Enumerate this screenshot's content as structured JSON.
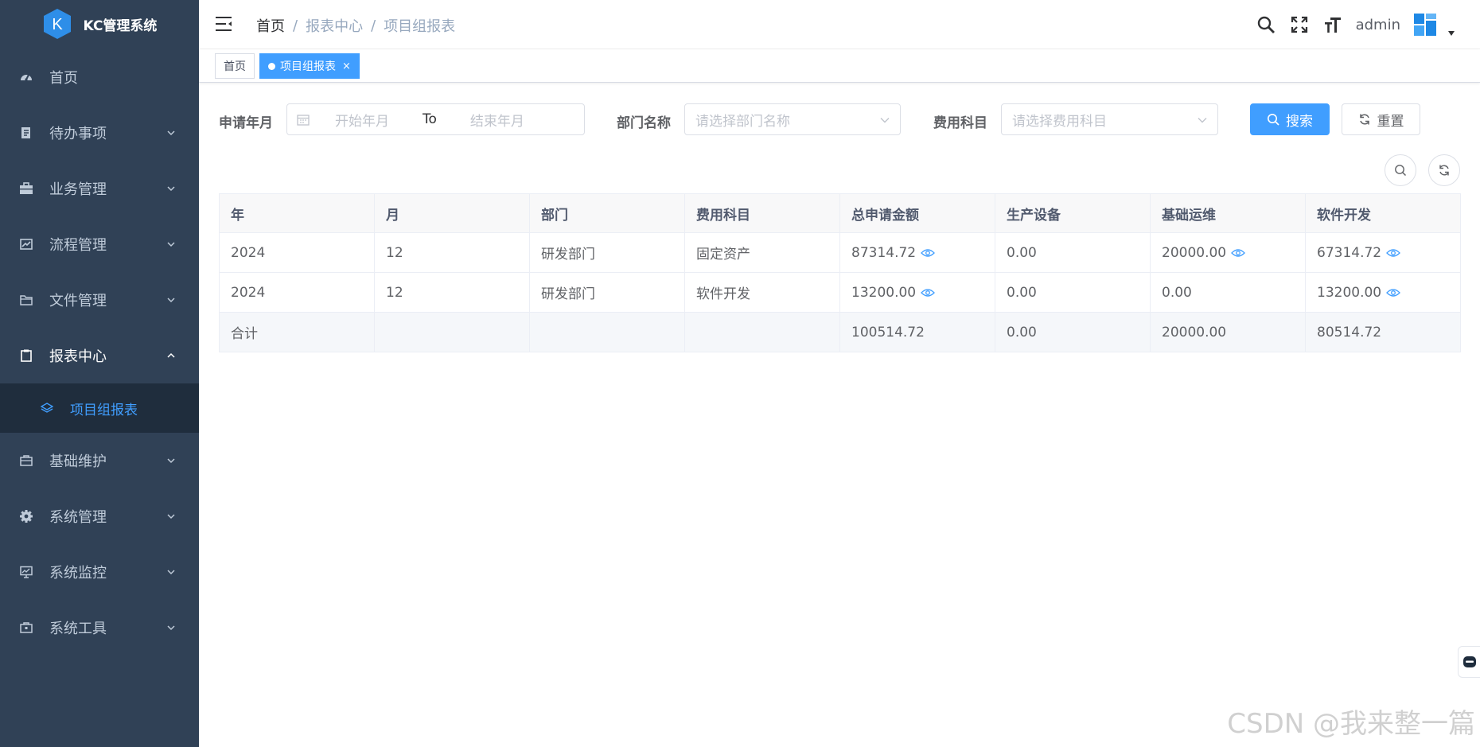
{
  "app": {
    "title": "KC管理系统"
  },
  "sidebar": {
    "items": [
      {
        "label": "首页",
        "icon": "dashboard-icon"
      },
      {
        "label": "待办事项",
        "icon": "todo-icon"
      },
      {
        "label": "业务管理",
        "icon": "briefcase-icon"
      },
      {
        "label": "流程管理",
        "icon": "flow-icon"
      },
      {
        "label": "文件管理",
        "icon": "folder-icon"
      },
      {
        "label": "报表中心",
        "icon": "clipboard-icon"
      },
      {
        "label": "基础维护",
        "icon": "toolbox-icon"
      },
      {
        "label": "系统管理",
        "icon": "gear-icon"
      },
      {
        "label": "系统监控",
        "icon": "monitor-icon"
      },
      {
        "label": "系统工具",
        "icon": "tool-icon"
      }
    ],
    "submenu": {
      "label": "项目组报表",
      "icon": "layers-icon"
    }
  },
  "breadcrumb": {
    "home": "首页",
    "sep": "/",
    "level1": "报表中心",
    "level2": "项目组报表"
  },
  "navbar": {
    "user": "admin"
  },
  "tags": {
    "home": "首页",
    "current": "项目组报表",
    "close": "×"
  },
  "filters": {
    "apply_month": {
      "label": "申请年月",
      "start_placeholder": "开始年月",
      "to": "To",
      "end_placeholder": "结束年月"
    },
    "dept": {
      "label": "部门名称",
      "placeholder": "请选择部门名称"
    },
    "subject": {
      "label": "费用科目",
      "placeholder": "请选择费用科目"
    },
    "search_label": "搜索",
    "reset_label": "重置"
  },
  "table": {
    "headers": [
      "年",
      "月",
      "部门",
      "费用科目",
      "总申请金额",
      "生产设备",
      "基础运维",
      "软件开发"
    ],
    "rows": [
      [
        "2024",
        "12",
        "研发部门",
        "固定资产",
        "87314.72",
        "0.00",
        "20000.00",
        "67314.72"
      ],
      [
        "2024",
        "12",
        "研发部门",
        "软件开发",
        "13200.00",
        "0.00",
        "0.00",
        "13200.00"
      ]
    ],
    "summary": [
      "合计",
      "",
      "",
      "",
      "100514.72",
      "0.00",
      "20000.00",
      "80514.72"
    ]
  },
  "watermark": "CSDN @我来整一篇",
  "colors": {
    "sidebar_bg": "#304156",
    "primary": "#409eff",
    "submenu_bg": "#1f2d3d"
  }
}
